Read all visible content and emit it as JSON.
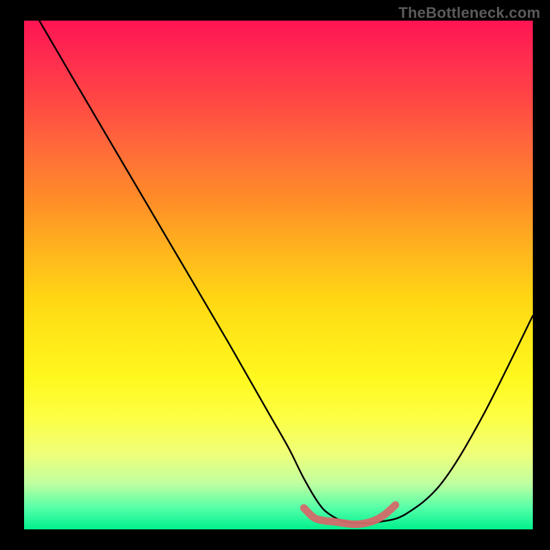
{
  "watermark": "TheBottleneck.com",
  "chart_data": {
    "type": "line",
    "title": "",
    "xlabel": "",
    "ylabel": "",
    "xlim": [
      0,
      100
    ],
    "ylim": [
      0,
      100
    ],
    "series": [
      {
        "name": "black-curve",
        "color": "#000000",
        "x": [
          3,
          10,
          20,
          30,
          40,
          48,
          52,
          55,
          58,
          60,
          63,
          66,
          70,
          75,
          82,
          90,
          100
        ],
        "y": [
          100,
          88,
          71,
          54,
          37,
          23,
          16,
          10,
          5,
          3,
          1.5,
          1.2,
          1.5,
          3,
          9,
          22,
          42
        ]
      },
      {
        "name": "red-band",
        "color": "#d46a6a",
        "x": [
          55,
          57,
          59,
          61,
          63,
          65,
          67,
          69,
          71,
          73
        ],
        "y": [
          4.2,
          2.3,
          1.7,
          1.5,
          1.2,
          1.0,
          1.2,
          1.8,
          3.0,
          4.8
        ]
      }
    ],
    "gradient_stops": [
      {
        "pos": 0,
        "color": "#ff1452"
      },
      {
        "pos": 15,
        "color": "#ff4545"
      },
      {
        "pos": 35,
        "color": "#ff8c28"
      },
      {
        "pos": 55,
        "color": "#ffd814"
      },
      {
        "pos": 78,
        "color": "#fcff44"
      },
      {
        "pos": 91,
        "color": "#c0ffa0"
      },
      {
        "pos": 100,
        "color": "#00f08c"
      }
    ]
  }
}
